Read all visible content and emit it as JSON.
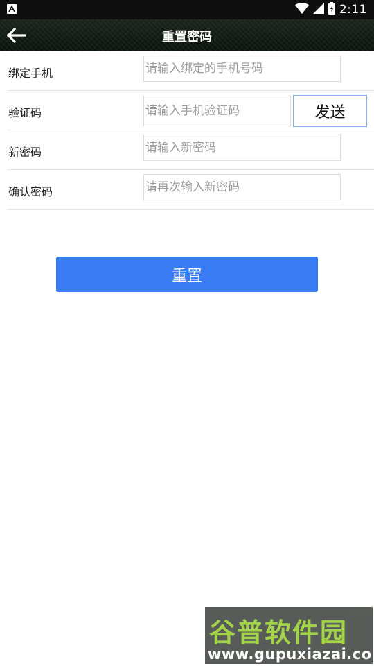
{
  "status_bar": {
    "time": "2:11",
    "icons": [
      "a-notification-icon",
      "wifi-icon",
      "cell-signal-icon",
      "battery-icon"
    ]
  },
  "header": {
    "title": "重置密码",
    "back_icon": "arrow-left-icon"
  },
  "form": {
    "phone": {
      "label": "绑定手机",
      "placeholder": "请输入绑定的手机号码"
    },
    "code": {
      "label": "验证码",
      "placeholder": "请输入手机验证码",
      "send_label": "发送"
    },
    "new_password": {
      "label": "新密码",
      "placeholder": "请输入新密码"
    },
    "confirm_password": {
      "label": "确认密码",
      "placeholder": "请再次输入新密码"
    }
  },
  "actions": {
    "reset_label": "重置"
  },
  "watermark": {
    "title": "谷普软件园",
    "url": "www.gupuxiazai.com"
  },
  "colors": {
    "accent": "#3a7cf6",
    "send_border": "#7fb2e6",
    "watermark_green": "#9cd03a"
  }
}
